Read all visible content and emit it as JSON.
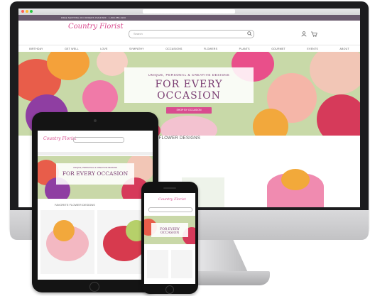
{
  "desktop": {
    "logo": "Country Florist",
    "search_placeholder": "Search",
    "promo": "FREE SHIPPING ON ORDERS OVER $59 · 1-800-555-0100",
    "nav": [
      "BIRTHDAY",
      "GET WELL",
      "LOVE",
      "SYMPATHY",
      "OCCASIONS",
      "FLOWERS",
      "PLANTS",
      "GOURMET",
      "EVENTS",
      "ABOUT"
    ],
    "hero_subtitle": "UNIQUE, PERSONAL & CREATIVE DESIGNS",
    "hero_title": "FOR EVERY OCCASION",
    "hero_button": "SHOP BY OCCASION",
    "section_title": "FAVORITE FLOWER DESIGNS"
  },
  "tablet": {
    "logo": "Country Florist",
    "hero_subtitle": "UNIQUE, PERSONAL & CREATIVE DESIGNS",
    "hero_title": "FOR EVERY OCCASION",
    "section_title": "FAVORITE FLOWER DESIGNS"
  },
  "phone": {
    "logo": "Country Florist",
    "hero_title": "FOR EVERY OCCASION"
  },
  "colors": {
    "brand_pink": "#d94c8f",
    "brand_plum": "#7a3d72",
    "device_dark": "#1d1d1f"
  }
}
